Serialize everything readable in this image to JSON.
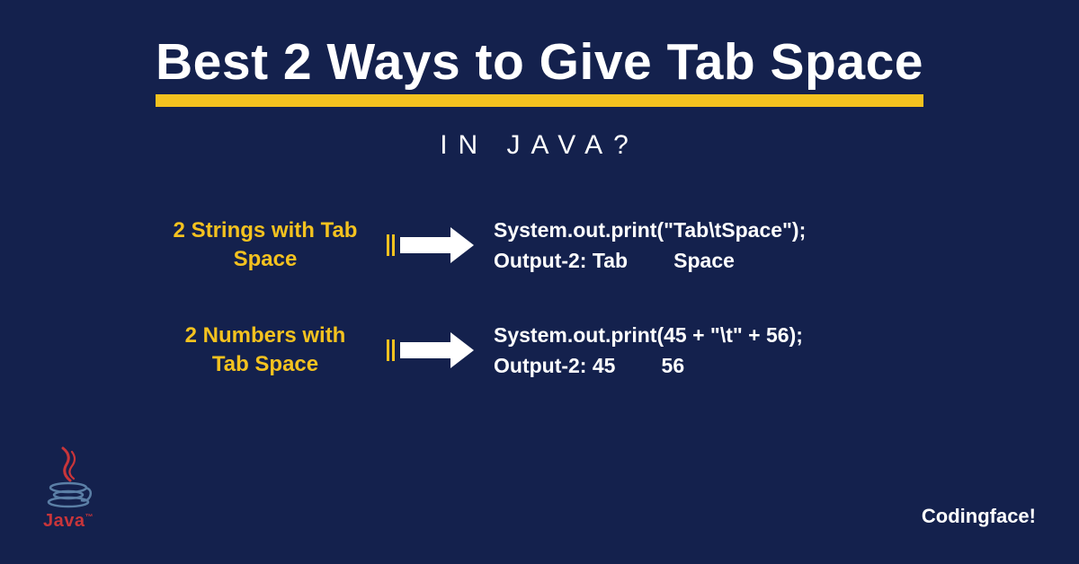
{
  "title": "Best 2 Ways to Give Tab Space",
  "subtitle": "IN JAVA?",
  "rows": [
    {
      "label": "2 Strings with Tab Space",
      "code_line1": "System.out.print(\"Tab\\tSpace\");",
      "code_line2": "Output-2: Tab        Space"
    },
    {
      "label": "2 Numbers with Tab Space",
      "code_line1": "System.out.print(45 + \"\\t\" + 56);",
      "code_line2": "Output-2: 45        56"
    }
  ],
  "logo_text": "Java",
  "logo_tm": "™",
  "brand": "Codingface!"
}
